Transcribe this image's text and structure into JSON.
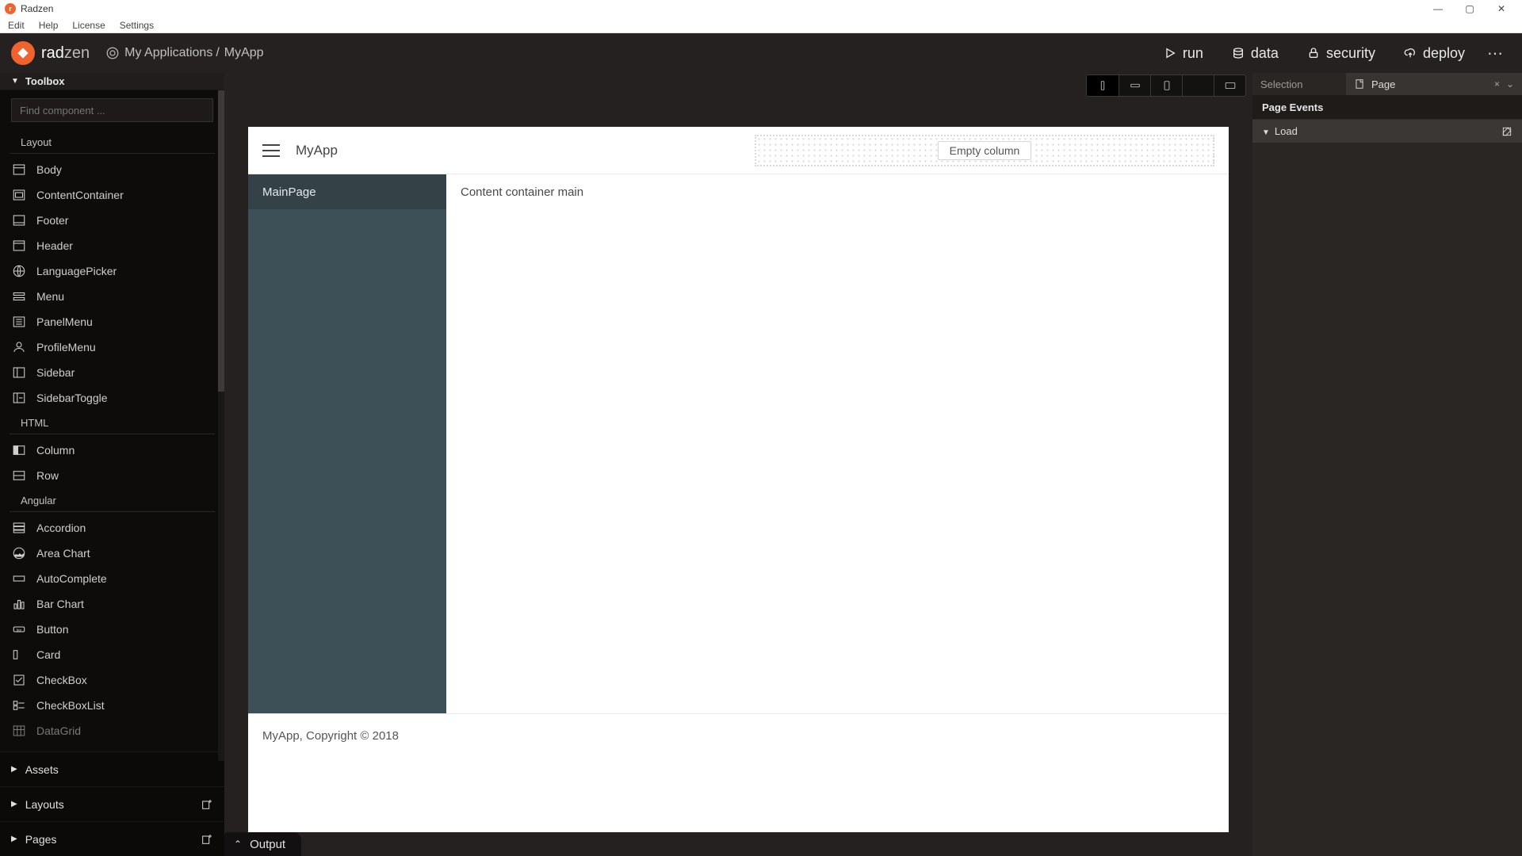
{
  "window": {
    "title": "Radzen"
  },
  "menubar": [
    "Edit",
    "Help",
    "License",
    "Settings"
  ],
  "brand": {
    "name_a": "rad",
    "name_b": "zen"
  },
  "breadcrumb": {
    "root": "My Applications",
    "sep": "/",
    "leaf": "MyApp"
  },
  "topactions": {
    "run": "run",
    "data": "data",
    "security": "security",
    "deploy": "deploy"
  },
  "toolbox": {
    "title": "Toolbox",
    "search_placeholder": "Find component ...",
    "groups": {
      "layout": {
        "title": "Layout",
        "items": [
          "Body",
          "ContentContainer",
          "Footer",
          "Header",
          "LanguagePicker",
          "Menu",
          "PanelMenu",
          "ProfileMenu",
          "Sidebar",
          "SidebarToggle"
        ]
      },
      "html": {
        "title": "HTML",
        "items": [
          "Column",
          "Row"
        ]
      },
      "angular": {
        "title": "Angular",
        "items": [
          "Accordion",
          "Area Chart",
          "AutoComplete",
          "Bar Chart",
          "Button",
          "Card",
          "CheckBox",
          "CheckBoxList",
          "DataGrid"
        ]
      }
    },
    "bottom": {
      "assets": "Assets",
      "layouts": "Layouts",
      "pages": "Pages"
    }
  },
  "canvas": {
    "header_title": "MyApp",
    "empty_col": "Empty column",
    "side_item": "MainPage",
    "main_text": "Content container main",
    "footer": "MyApp, Copyright © 2018"
  },
  "output": {
    "label": "Output"
  },
  "props": {
    "selection_label": "Selection",
    "page_label": "Page",
    "events_title": "Page Events",
    "event_load": "Load"
  }
}
